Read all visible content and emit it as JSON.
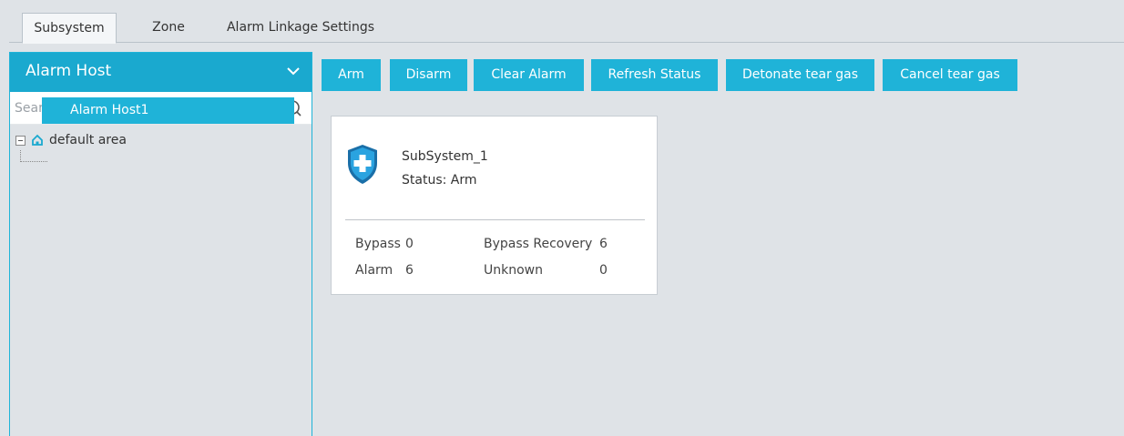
{
  "tabs": [
    {
      "label": "Subsystem",
      "active": true
    },
    {
      "label": "Zone",
      "active": false
    },
    {
      "label": "Alarm Linkage Settings",
      "active": false
    }
  ],
  "sidebar": {
    "title": "Alarm Host",
    "search_placeholder": "Search",
    "tree": {
      "root_label": "default area",
      "children": [
        "Alarm Host1"
      ]
    }
  },
  "toolbar": {
    "arm": "Arm",
    "disarm": "Disarm",
    "clear_alarm": "Clear Alarm",
    "refresh_status": "Refresh Status",
    "detonate": "Detonate tear gas",
    "cancel": "Cancel tear gas"
  },
  "subsystem_card": {
    "name": "SubSystem_1",
    "status": "Status: Arm",
    "bypass_label": "Bypass",
    "bypass_value": "0",
    "bypass_recovery_label": "Bypass Recovery",
    "bypass_recovery_value": "6",
    "alarm_label": "Alarm",
    "alarm_value": "6",
    "unknown_label": "Unknown",
    "unknown_value": "0"
  },
  "colors": {
    "accent": "#1fb3d8",
    "header": "#1aa9cf",
    "background": "#dfe3e7"
  }
}
